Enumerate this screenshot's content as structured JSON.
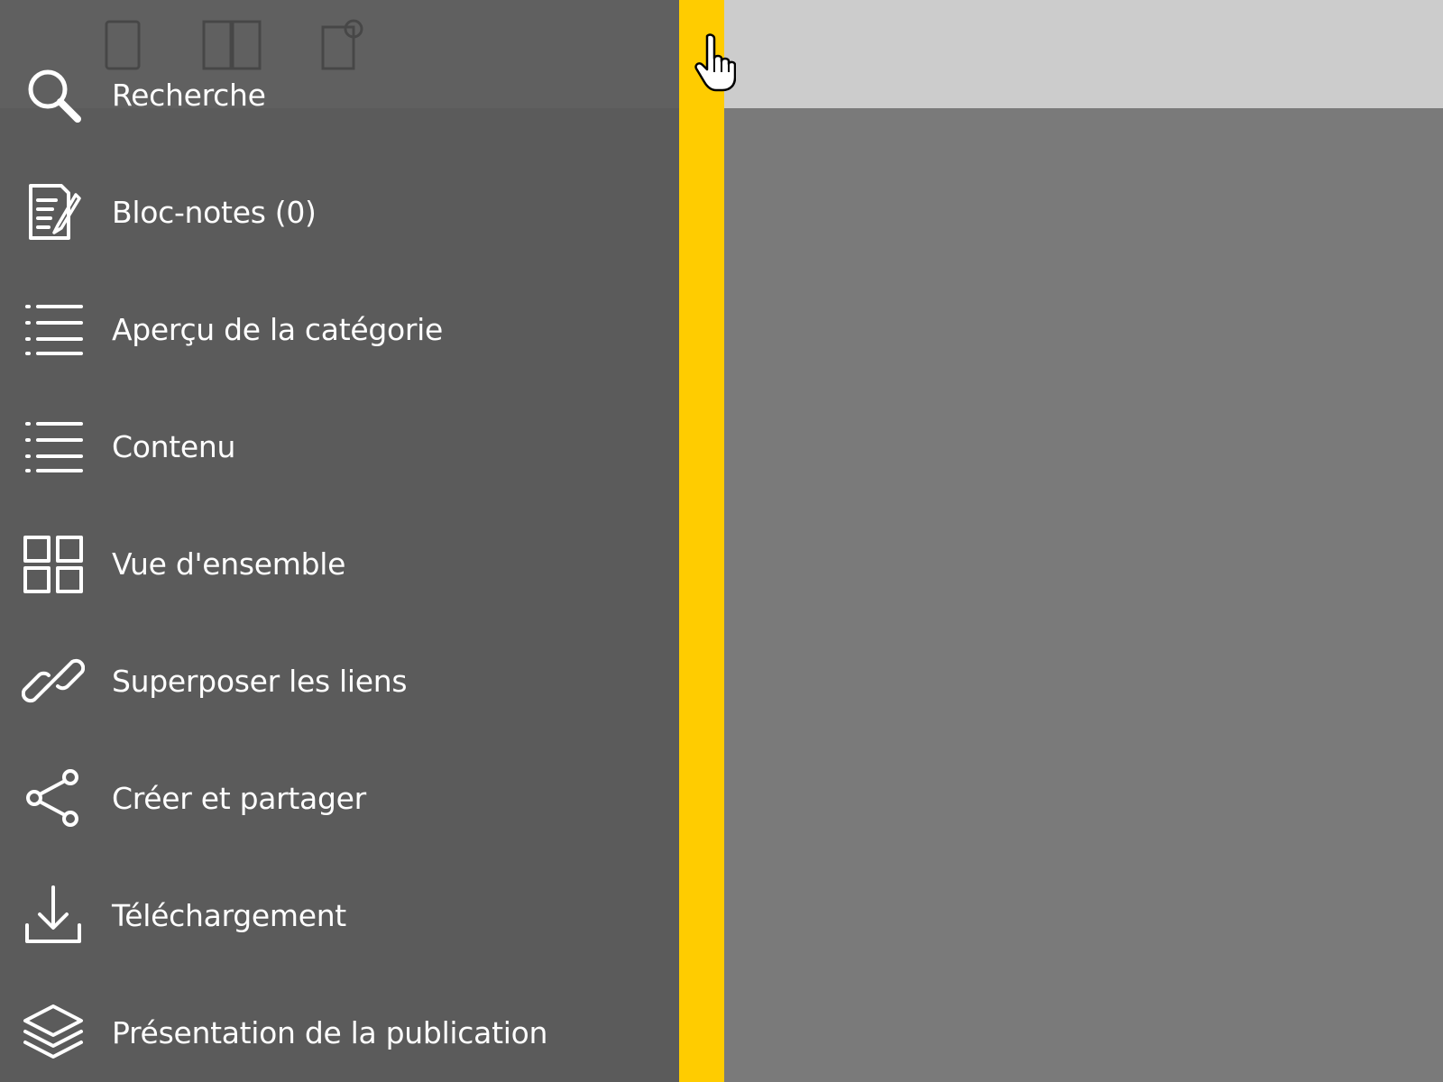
{
  "menu": {
    "items": [
      {
        "id": "search",
        "icon": "search-icon",
        "label": "Recherche"
      },
      {
        "id": "notepad",
        "icon": "notepad-icon",
        "label": "Bloc-notes (0)"
      },
      {
        "id": "category-overview",
        "icon": "list-icon",
        "label": "Aperçu de la catégorie"
      },
      {
        "id": "contents",
        "icon": "list-icon",
        "label": "Contenu"
      },
      {
        "id": "overview",
        "icon": "grid-icon",
        "label": "Vue d'ensemble"
      },
      {
        "id": "overlay-links",
        "icon": "link-icon",
        "label": "Superposer les liens"
      },
      {
        "id": "create-share",
        "icon": "share-icon",
        "label": "Créer et partager"
      },
      {
        "id": "download",
        "icon": "download-icon",
        "label": "Téléchargement"
      },
      {
        "id": "publication-presentation",
        "icon": "layers-icon",
        "label": "Présentation de la publication"
      }
    ]
  },
  "colors": {
    "menu_background": "#5b5b5b",
    "splitter": "#ffcc00",
    "main_background": "#7a7a7a",
    "main_topbar": "#cccccc",
    "text": "#ffffff"
  }
}
